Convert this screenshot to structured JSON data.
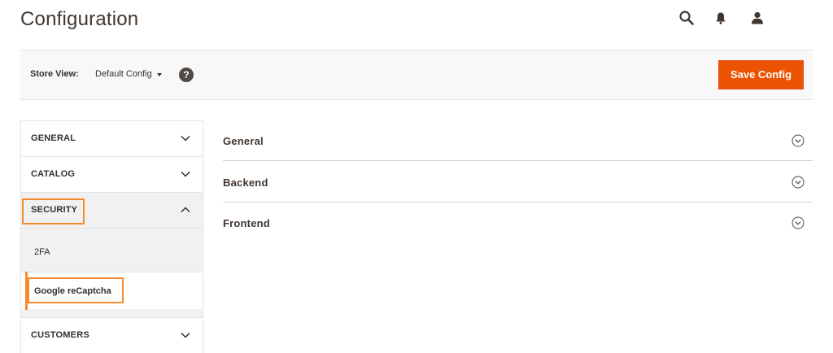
{
  "page": {
    "title": "Configuration"
  },
  "header_icons": [
    "search-icon",
    "bell-icon",
    "user-icon"
  ],
  "store_view": {
    "label": "Store View:",
    "selected": "Default Config",
    "help": "?",
    "save_label": "Save Config"
  },
  "sidebar": {
    "groups": {
      "general": {
        "label": "GENERAL"
      },
      "catalog": {
        "label": "CATALOG"
      },
      "security": {
        "label": "SECURITY",
        "items": {
          "twofa": "2FA",
          "recaptcha": "Google reCaptcha"
        }
      },
      "customers": {
        "label": "CUSTOMERS"
      }
    }
  },
  "main": {
    "sections": {
      "general": "General",
      "backend": "Backend",
      "frontend": "Frontend"
    }
  },
  "colors": {
    "accent": "#eb5202",
    "highlight": "#f58a2c",
    "title": "#41362f",
    "panel": "#f8f8f8"
  }
}
